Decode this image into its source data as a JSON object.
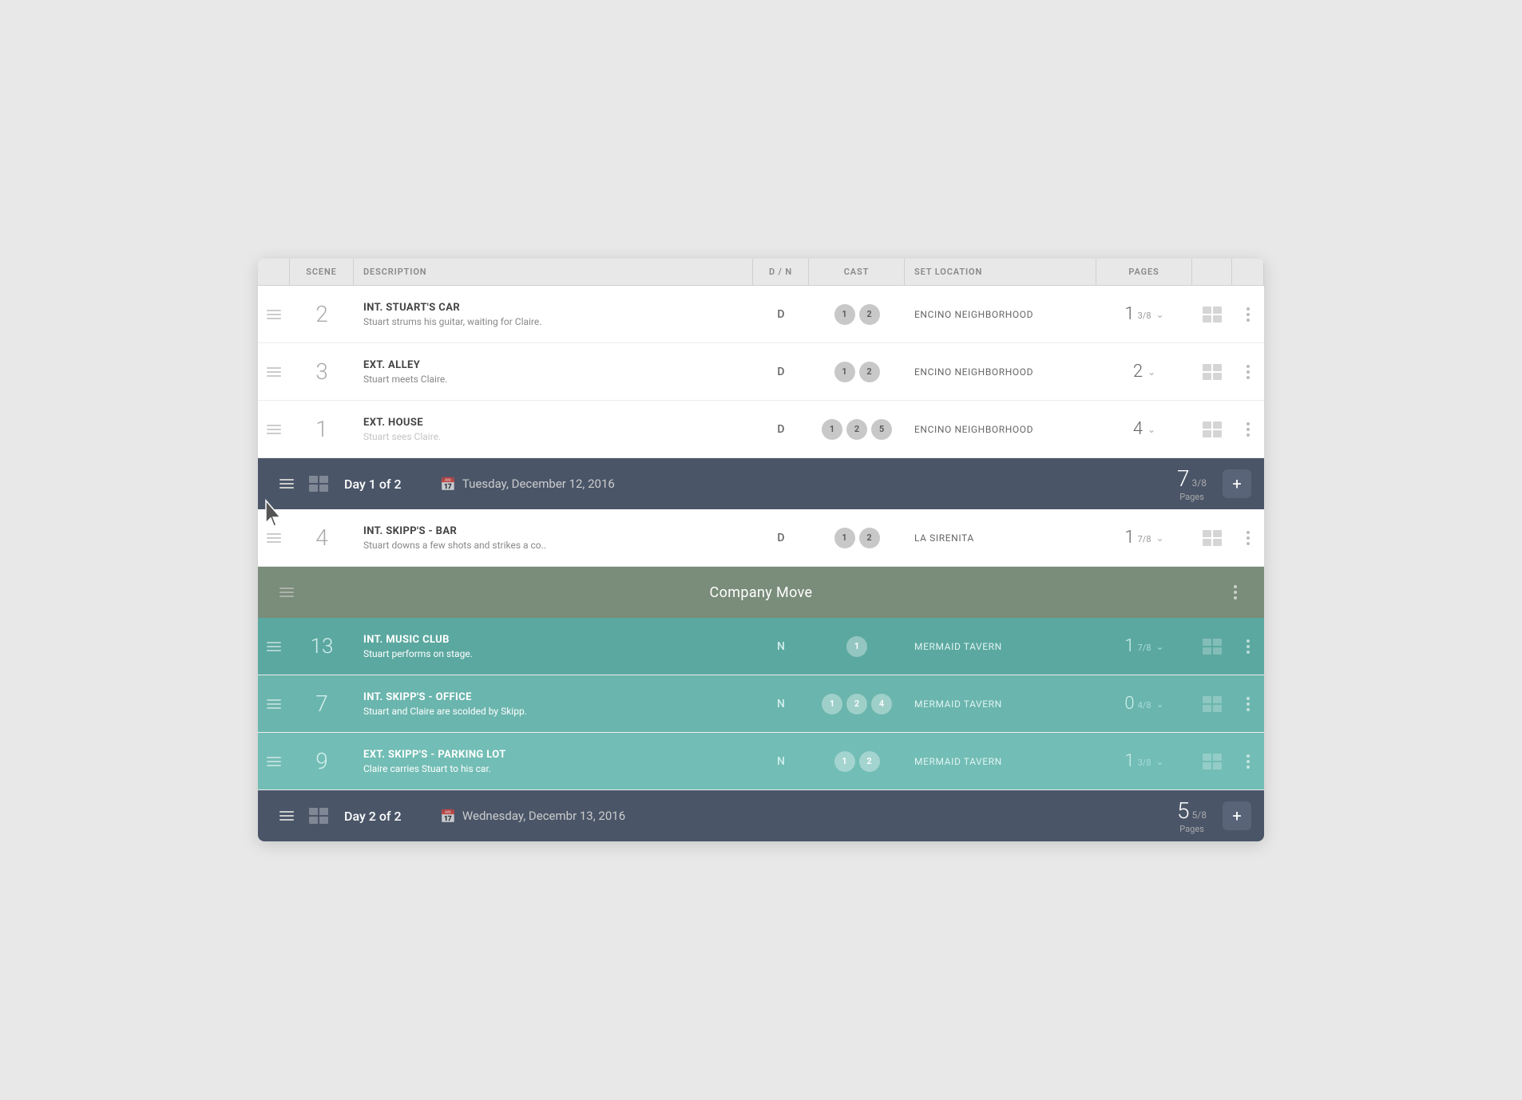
{
  "header": {
    "cols": [
      "SCENE",
      "DESCRIPTION",
      "D / N",
      "CAST",
      "SET LOCATION",
      "PAGES"
    ]
  },
  "rows": [
    {
      "type": "scene",
      "id": "row-2",
      "num": "2",
      "title": "INT. STUART'S CAR",
      "desc": "Stuart strums his guitar, waiting for Claire.",
      "dn": "D",
      "cast": [
        "1",
        "2"
      ],
      "location": "ENCINO NEIGHBORHOOD",
      "pages": "1",
      "pages_frac": "3/8",
      "bg": "white"
    },
    {
      "type": "scene",
      "id": "row-3",
      "num": "3",
      "title": "EXT. ALLEY",
      "desc": "Stuart meets Claire.",
      "dn": "D",
      "cast": [
        "1",
        "2"
      ],
      "location": "ENCINO NEIGHBORHOOD",
      "pages": "2",
      "pages_frac": "",
      "bg": "white"
    },
    {
      "type": "scene",
      "id": "row-1",
      "num": "1",
      "title": "EXT. HOUSE",
      "desc": "Stuart sees Claire.",
      "dn": "D",
      "cast": [
        "1",
        "2",
        "5"
      ],
      "location": "ENCINO NEIGHBORHOOD",
      "pages": "4",
      "pages_frac": "",
      "bg": "white",
      "truncated": true
    },
    {
      "type": "day",
      "id": "day-1",
      "label": "Day 1 of 2",
      "date": "Tuesday, December 12, 2016",
      "pages_big": "7",
      "pages_frac": "3/8",
      "pages_label": "Pages"
    },
    {
      "type": "scene",
      "id": "row-4",
      "num": "4",
      "title": "INT. SKIPP'S - BAR",
      "desc": "Stuart downs a few shots and strikes a co..",
      "dn": "D",
      "cast": [
        "1",
        "2"
      ],
      "location": "LA SIRENITA",
      "pages": "1",
      "pages_frac": "7/8",
      "bg": "white"
    },
    {
      "type": "company_move",
      "id": "company-move",
      "label": "Company Move"
    },
    {
      "type": "scene",
      "id": "row-13",
      "num": "13",
      "title": "INT. MUSIC CLUB",
      "desc": "Stuart performs on stage.",
      "dn": "N",
      "cast": [
        "1"
      ],
      "location": "MERMAID TAVERN",
      "pages": "1",
      "pages_frac": "7/8",
      "bg": "teal"
    },
    {
      "type": "scene",
      "id": "row-7",
      "num": "7",
      "title": "INT. SKIPP'S - OFFICE",
      "desc": "Stuart and Claire are scolded by Skipp.",
      "dn": "N",
      "cast": [
        "1",
        "2",
        "4"
      ],
      "location": "MERMAID TAVERN",
      "pages": "0",
      "pages_frac": "4/8",
      "bg": "teal-light"
    },
    {
      "type": "scene",
      "id": "row-9",
      "num": "9",
      "title": "EXT. SKIPP'S - PARKING LOT",
      "desc": "Claire carries Stuart to his car.",
      "dn": "N",
      "cast": [
        "1",
        "2"
      ],
      "location": "MERMAID TAVERN",
      "pages": "1",
      "pages_frac": "3/8",
      "bg": "teal-lighter"
    },
    {
      "type": "day",
      "id": "day-2",
      "label": "Day 2 of 2",
      "date": "Wednesday, Decembr 13, 2016",
      "pages_big": "5",
      "pages_frac": "5/8",
      "pages_label": "Pages"
    }
  ],
  "colors": {
    "teal": "#5ba8a0",
    "teal_light": "#5eada5",
    "teal_lighter": "#62b2aa",
    "day_bar": "#4a5568",
    "company_move": "#7a8c7a"
  }
}
